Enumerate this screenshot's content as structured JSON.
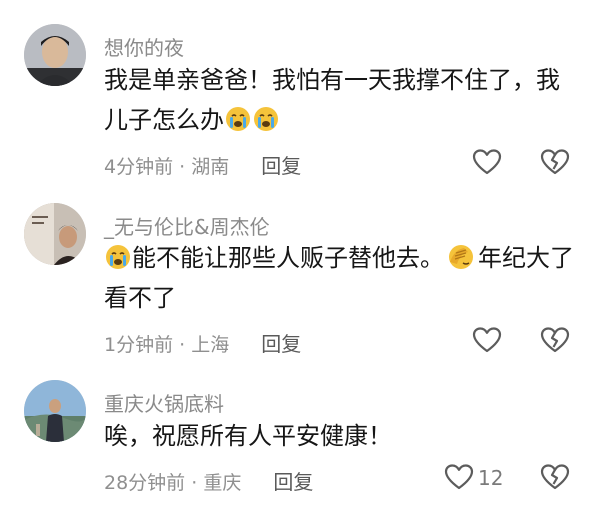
{
  "comments": [
    {
      "username": "想你的夜",
      "text_parts": [
        "我是单亲爸爸！我怕有一天我撑不住了，我儿子怎么办",
        "crying-face-icon",
        "crying-face-icon"
      ],
      "text": "我是单亲爸爸！我怕有一天我撑不住了，我儿子怎么办",
      "time": "4分钟前",
      "location": "湖南",
      "reply_label": "回复",
      "like_count": "",
      "avatar_icon": "man-portrait-avatar"
    },
    {
      "username": "_无与伦比&周杰伦",
      "text_before": "能不能让那些人贩子替他去。",
      "text_after": "年纪大了看不了",
      "leading_emoji": "crying-face-icon",
      "middle_emoji": "face-palm-icon",
      "time": "1分钟前",
      "location": "上海",
      "reply_label": "回复",
      "like_count": "",
      "avatar_icon": "artist-photo-avatar"
    },
    {
      "username": "重庆火锅底料",
      "text": "唉，祝愿所有人平安健康！",
      "time": "28分钟前",
      "location": "重庆",
      "reply_label": "回复",
      "like_count": "12",
      "avatar_icon": "landscape-portrait-avatar"
    }
  ],
  "icons": {
    "like": "heart-outline-icon",
    "dislike": "broken-heart-icon"
  },
  "colors": {
    "username": "#8a8a8a",
    "text": "#161616",
    "meta": "#8f8f8f",
    "emoji_yellow": "#f5c33b"
  }
}
